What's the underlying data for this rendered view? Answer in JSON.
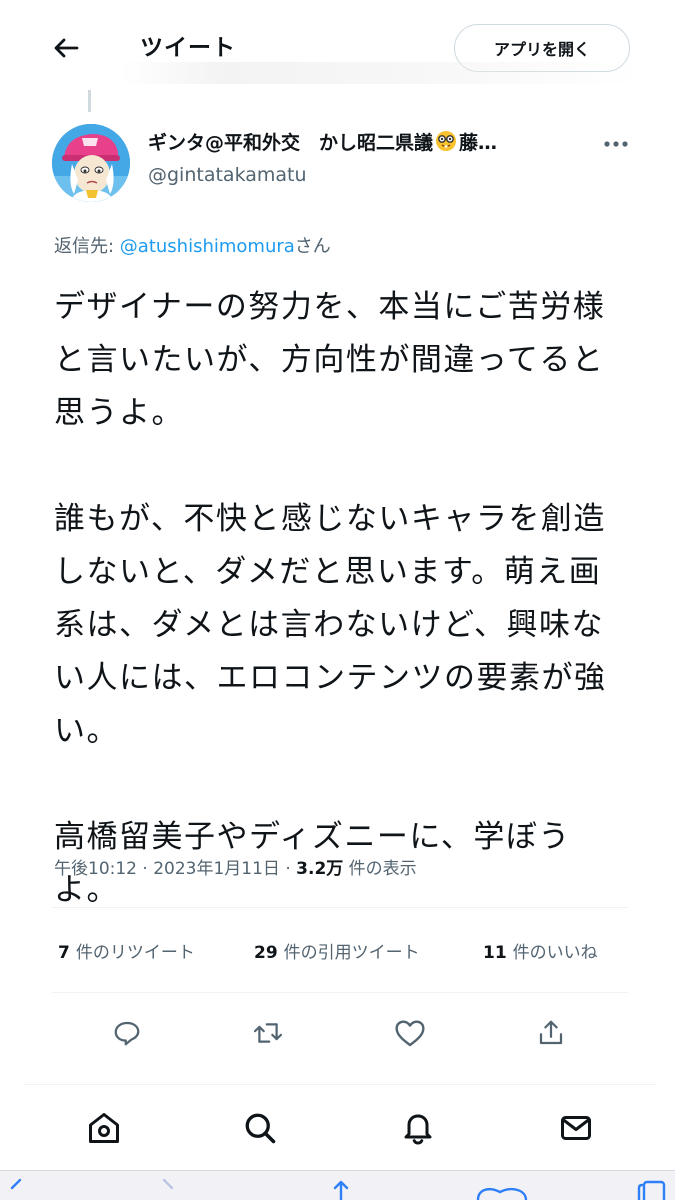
{
  "header": {
    "title": "ツイート",
    "open_app_label": "アプリを開く"
  },
  "tweet": {
    "display_name_part1": "ギンタ@平和外交　かし昭二県議",
    "display_name_part2": "藤…",
    "handle": "@gintatakamatu",
    "reply_prefix": "返信先: ",
    "reply_mention": "@atushishimomura",
    "reply_suffix": "さん",
    "body": "デザイナーの努力を、本当にご苦労様と言いたいが、方向性が間違ってると思うよ。\n\n誰もが、不快と感じないキャラを創造しないと、ダメだと思います。萌え画系は、ダメとは言わないけど、興味ない人には、エロコンテンツの要素が強い。\n\n高橋留美子やディズニーに、学ぼうよ。",
    "time": "午後10:12",
    "date": "2023年1月11日",
    "sep": " · ",
    "views_count": "3.2万",
    "views_label": " 件の表示"
  },
  "stats": {
    "retweets_count": "7",
    "retweets_label": "件のリツイート",
    "quotes_count": "29",
    "quotes_label": "件の引用ツイート",
    "likes_count": "11",
    "likes_label": "件のいいね"
  },
  "icons": {
    "back": "arrow-left-icon",
    "more": "more-icon",
    "reply": "reply-icon",
    "retweet": "retweet-icon",
    "like": "heart-icon",
    "share": "share-icon",
    "home": "home-icon",
    "search": "search-icon",
    "notifications": "bell-icon",
    "messages": "mail-icon"
  },
  "colors": {
    "accent": "#1d9bf0",
    "text": "#0f1419",
    "secondary": "#536471",
    "border": "#cfd9de"
  }
}
